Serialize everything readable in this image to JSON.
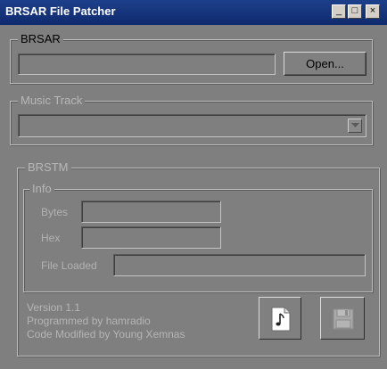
{
  "window": {
    "title": "BRSAR File Patcher"
  },
  "title_buttons": {
    "minimize": "_",
    "maximize": "□",
    "close": "×"
  },
  "brsar": {
    "legend": "BRSAR",
    "path_value": "",
    "open_label": "Open..."
  },
  "music": {
    "legend": "Music Track",
    "selected": ""
  },
  "brstm": {
    "legend": "BRSTM",
    "info": {
      "legend": "Info",
      "bytes_label": "Bytes",
      "bytes_value": "",
      "hex_label": "Hex",
      "hex_value": "",
      "file_label": "File Loaded",
      "file_value": ""
    },
    "about": {
      "line1": "Version 1.1",
      "line2": "Programmed by hamradio",
      "line3": "Code Modified by Young Xemnas"
    }
  },
  "icons": {
    "load_brstm": "music-note-icon",
    "save": "floppy-disk-icon"
  }
}
